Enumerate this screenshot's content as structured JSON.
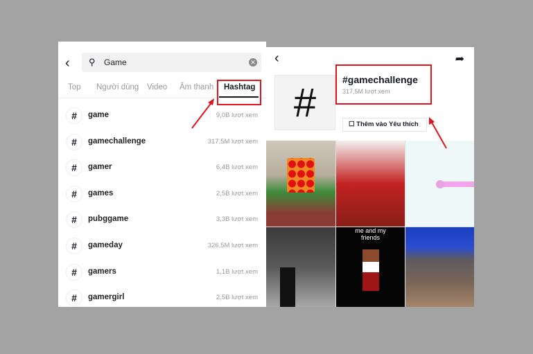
{
  "search": {
    "query": "Game",
    "tabs": [
      "Top",
      "Người dùng",
      "Video",
      "Âm thanh",
      "Hashtag"
    ],
    "active_tab": "Hashtag",
    "results": [
      {
        "name": "game",
        "views": "9,0B lượt xem"
      },
      {
        "name": "gamechallenge",
        "views": "317,5M lượt xem"
      },
      {
        "name": "gamer",
        "views": "6,4B lượt xem"
      },
      {
        "name": "games",
        "views": "2,5B lượt xem"
      },
      {
        "name": "pubggame",
        "views": "3,3B lượt xem"
      },
      {
        "name": "gameday",
        "views": "326,5M lượt xem"
      },
      {
        "name": "gamers",
        "views": "1,1B lượt xem"
      },
      {
        "name": "gamergirl",
        "views": "2,5B lượt xem"
      }
    ]
  },
  "detail": {
    "title": "#gamechallenge",
    "views": "317,5M lượt xem",
    "favorite_label": "Thêm vào Yêu thích",
    "hash_symbol": "#",
    "video_caption": "me and my friends"
  },
  "colors": {
    "highlight": "#e0141e"
  }
}
